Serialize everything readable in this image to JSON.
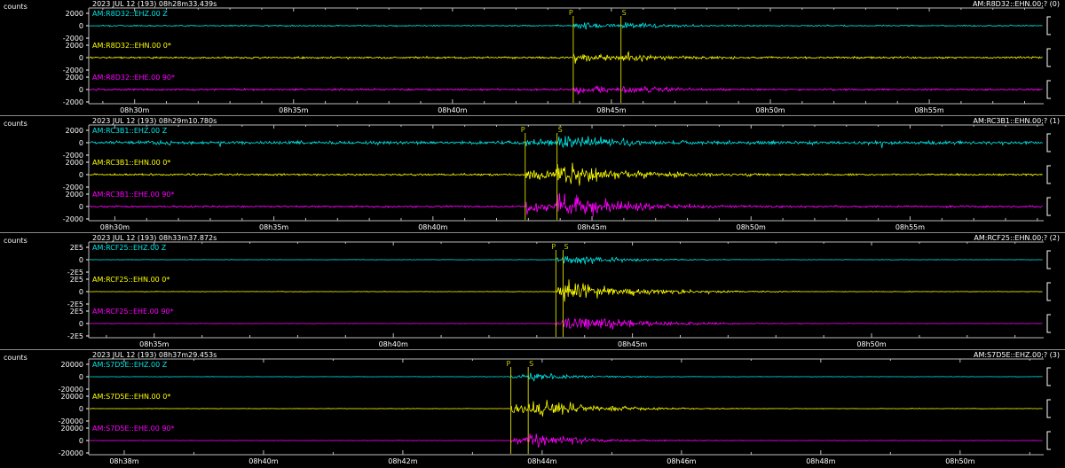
{
  "colors": {
    "background": "#000000",
    "trace1": "#00e5e5",
    "trace2": "#ffff00",
    "trace3": "#ff00ff",
    "pick": "#c8c800",
    "text": "#ffffff",
    "frame": "#cccccc"
  },
  "panels": [
    {
      "counts_label": "counts",
      "header_time": "2023 JUL 12 (193)  08h28m33.439s",
      "header_channel": "AM:R8D32::EHN.00;? (0)",
      "y_ticks": [
        "2000",
        "0",
        "-2000"
      ],
      "x_ticks": [
        "08h30m",
        "08h35m",
        "08h40m",
        "08h45m",
        "08h50m",
        "08h55m"
      ],
      "x_tick_minutes": [
        30,
        35,
        40,
        45,
        50,
        55
      ],
      "start_min": 28.557,
      "end_min": 58.6,
      "p_min": 43.8,
      "s_min": 45.3,
      "traces": [
        {
          "label": "AM:R8D32::EHZ.00 Z",
          "color": "#00e5e5",
          "noise": 0.08,
          "peak": 0.8,
          "decay": 0.9
        },
        {
          "label": "AM:R8D32::EHN.00 0*",
          "color": "#ffff00",
          "noise": 0.12,
          "peak": 1.0,
          "decay": 0.9
        },
        {
          "label": "AM:R8D32::EHE.00 90*",
          "color": "#ff00ff",
          "noise": 0.12,
          "peak": 1.0,
          "decay": 0.9
        }
      ],
      "phases": [
        "P",
        "S"
      ]
    },
    {
      "counts_label": "counts",
      "header_time": "2023 JUL 12 (193)  08h29m10.780s",
      "header_channel": "AM:RC3B1::EHN.00;? (1)",
      "y_ticks": [
        "2000",
        "0",
        "-2000"
      ],
      "x_ticks": [
        "08h30m",
        "08h35m",
        "08h40m",
        "08h45m",
        "08h50m",
        "08h55m"
      ],
      "x_tick_minutes": [
        30,
        35,
        40,
        45,
        50,
        55
      ],
      "start_min": 29.18,
      "end_min": 59.2,
      "p_min": 42.9,
      "s_min": 43.9,
      "traces": [
        {
          "label": "AM:RC3B1::EHZ.00 Z",
          "color": "#00e5e5",
          "noise": 0.22,
          "peak": 1.0,
          "decay": 1.2
        },
        {
          "label": "AM:RC3B1::EHN.00 0*",
          "color": "#ffff00",
          "noise": 0.12,
          "peak": 1.3,
          "decay": 1.4
        },
        {
          "label": "AM:RC3B1::EHE.00 90*",
          "color": "#ff00ff",
          "noise": 0.12,
          "peak": 1.3,
          "decay": 1.4
        }
      ],
      "phases": [
        "P",
        "S"
      ]
    },
    {
      "counts_label": "counts",
      "header_time": "2023 JUL 12 (193)  08h33m37.872s",
      "header_channel": "AM:RCF25::EHN.00;? (2)",
      "y_ticks": [
        "2E5",
        "0",
        "-2E5"
      ],
      "x_ticks": [
        "08h35m",
        "08h40m",
        "08h45m",
        "08h50m"
      ],
      "x_tick_minutes": [
        35,
        40,
        45,
        50
      ],
      "start_min": 33.631,
      "end_min": 53.6,
      "p_min": 43.4,
      "s_min": 43.55,
      "traces": [
        {
          "label": "AM:RCF25::EHZ.00 Z",
          "color": "#00e5e5",
          "noise": 0.03,
          "peak": 0.45,
          "decay": 1.0
        },
        {
          "label": "AM:RCF25::EHN.00 0*",
          "color": "#ffff00",
          "noise": 0.03,
          "peak": 0.8,
          "decay": 1.3
        },
        {
          "label": "AM:RCF25::EHE.00 90*",
          "color": "#ff00ff",
          "noise": 0.03,
          "peak": 0.75,
          "decay": 1.3
        }
      ],
      "phases": [
        "P",
        "S"
      ]
    },
    {
      "counts_label": "counts",
      "header_time": "2023 JUL 12 (193)  08h37m29.453s",
      "header_channel": "AM:S7D5E::EHZ.00;? (3)",
      "y_ticks": [
        "20000",
        "0",
        "-20000"
      ],
      "x_ticks": [
        "08h38m",
        "08h40m",
        "08h42m",
        "08h44m",
        "08h46m",
        "08h48m",
        "08h50m"
      ],
      "x_tick_minutes": [
        38,
        40,
        42,
        44,
        46,
        48,
        50
      ],
      "start_min": 37.491,
      "end_min": 51.2,
      "p_min": 43.55,
      "s_min": 43.8,
      "traces": [
        {
          "label": "AM:S7D5E::EHZ.00 Z",
          "color": "#00e5e5",
          "noise": 0.03,
          "peak": 0.45,
          "decay": 0.9
        },
        {
          "label": "AM:S7D5E::EHN.00 0*",
          "color": "#ffff00",
          "noise": 0.03,
          "peak": 1.0,
          "decay": 1.1
        },
        {
          "label": "AM:S7D5E::EHE.00 90*",
          "color": "#ff00ff",
          "noise": 0.03,
          "peak": 0.7,
          "decay": 1.0
        }
      ],
      "phases": [
        "P",
        "S"
      ]
    }
  ]
}
